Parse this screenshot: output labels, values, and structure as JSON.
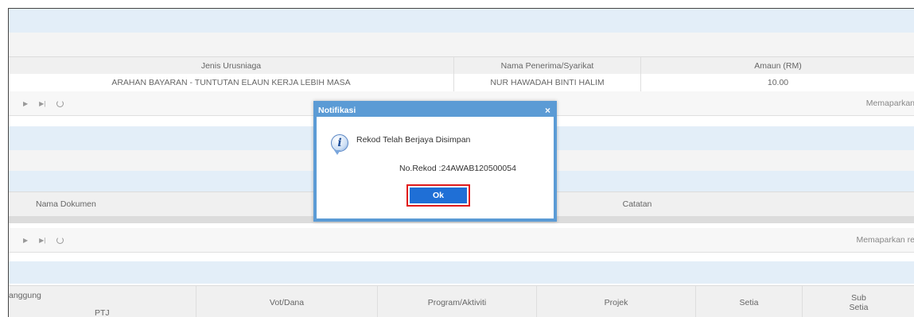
{
  "payment_table": {
    "headers": [
      "Jenis Urusniaga",
      "Nama Penerima/Syarikat",
      "Amaun (RM)"
    ],
    "row": [
      "ARAHAN BAYARAN - TUNTUTAN ELAUN KERJA LEBIH MASA",
      "NUR HAWADAH BINTI HALIM",
      "10.00"
    ]
  },
  "pager1": {
    "status": "Memaparkan"
  },
  "documents_table": {
    "headers": [
      "Nama Dokumen",
      "Catatan"
    ]
  },
  "pager2": {
    "status": "Memaparkan re"
  },
  "bottom_table": {
    "headers": [
      "anggung",
      "PTJ",
      "Vot/Dana",
      "Program/Aktiviti",
      "Projek",
      "Setia",
      "Sub",
      "Setia"
    ]
  },
  "dialog": {
    "title": "Notifikasi",
    "close_label": "×",
    "message": "Rekod Telah Berjaya Disimpan",
    "record_no": "No.Rekod :24AWAB120500054",
    "ok_label": "Ok",
    "info_glyph": "i"
  },
  "icons": {
    "next": "▶",
    "last": "▶|"
  },
  "colors": {
    "dialog_border": "#5b9bd5",
    "ok_button": "#1f6fd6",
    "highlight": "#e21b1b",
    "band": "#e3eef8"
  }
}
